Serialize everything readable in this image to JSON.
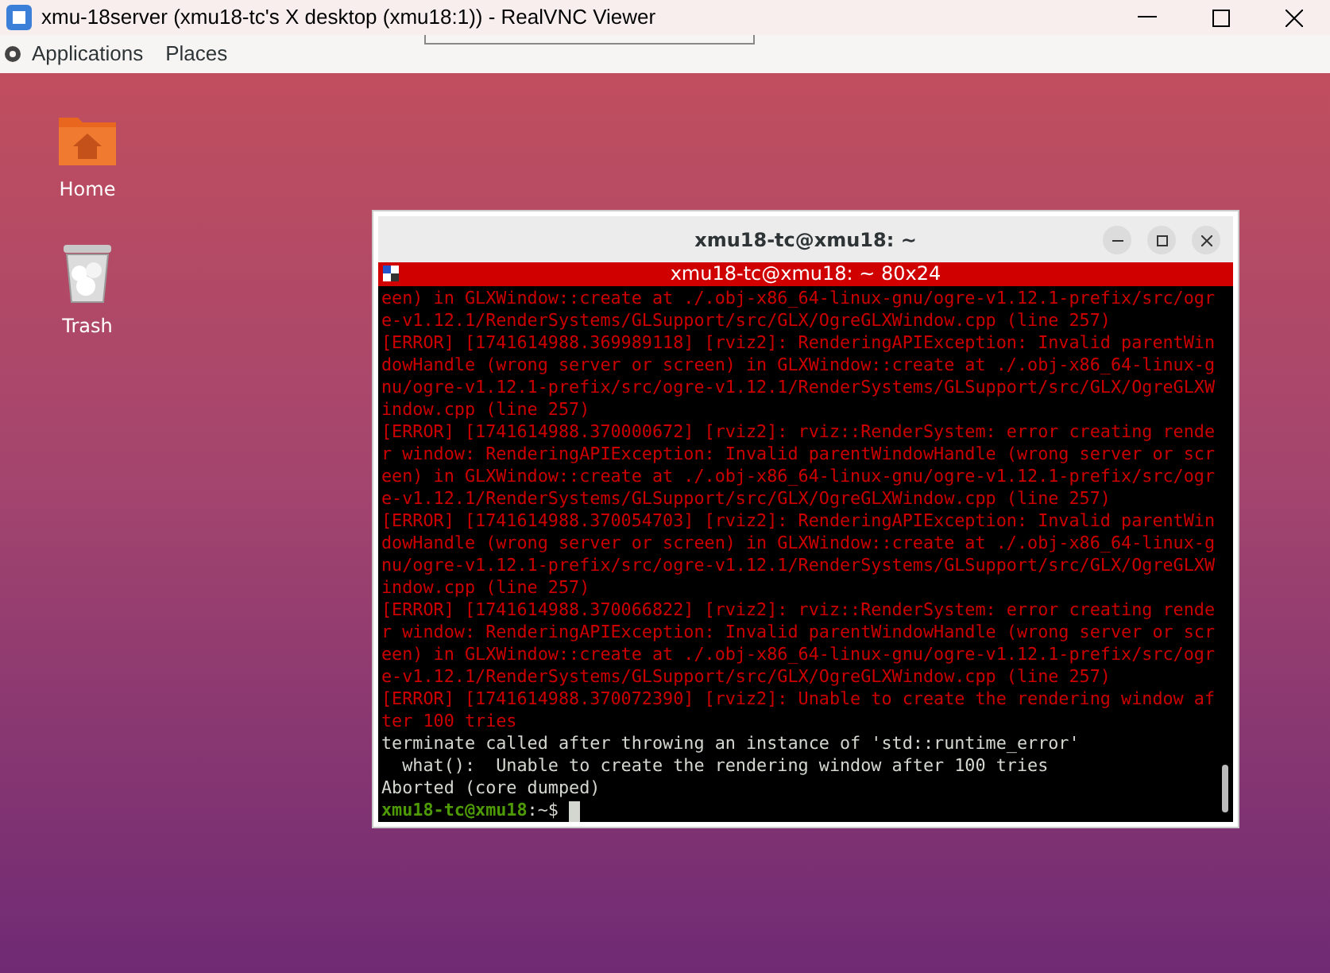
{
  "window": {
    "title": "xmu-18server (xmu18-tc's X desktop (xmu18:1)) - RealVNC Viewer"
  },
  "top_panel": {
    "menus": [
      "Applications",
      "Places"
    ]
  },
  "desktop_icons": [
    {
      "kind": "folder",
      "label": "Home"
    },
    {
      "kind": "trash",
      "label": "Trash"
    }
  ],
  "terminal": {
    "title": "xmu18-tc@xmu18: ~",
    "bar_title": "xmu18-tc@xmu18: ~ 80x24",
    "lines": [
      {
        "kind": "error",
        "text": "een) in GLXWindow::create at ./.obj-x86_64-linux-gnu/ogre-v1.12.1-prefix/src/ogr"
      },
      {
        "kind": "error",
        "text": "e-v1.12.1/RenderSystems/GLSupport/src/GLX/OgreGLXWindow.cpp (line 257)"
      },
      {
        "kind": "error",
        "text": "[ERROR] [1741614988.369989118] [rviz2]: RenderingAPIException: Invalid parentWin"
      },
      {
        "kind": "error",
        "text": "dowHandle (wrong server or screen) in GLXWindow::create at ./.obj-x86_64-linux-g"
      },
      {
        "kind": "error",
        "text": "nu/ogre-v1.12.1-prefix/src/ogre-v1.12.1/RenderSystems/GLSupport/src/GLX/OgreGLXW"
      },
      {
        "kind": "error",
        "text": "indow.cpp (line 257)"
      },
      {
        "kind": "error",
        "text": "[ERROR] [1741614988.370000672] [rviz2]: rviz::RenderSystem: error creating rende"
      },
      {
        "kind": "error",
        "text": "r window: RenderingAPIException: Invalid parentWindowHandle (wrong server or scr"
      },
      {
        "kind": "error",
        "text": "een) in GLXWindow::create at ./.obj-x86_64-linux-gnu/ogre-v1.12.1-prefix/src/ogr"
      },
      {
        "kind": "error",
        "text": "e-v1.12.1/RenderSystems/GLSupport/src/GLX/OgreGLXWindow.cpp (line 257)"
      },
      {
        "kind": "error",
        "text": "[ERROR] [1741614988.370054703] [rviz2]: RenderingAPIException: Invalid parentWin"
      },
      {
        "kind": "error",
        "text": "dowHandle (wrong server or screen) in GLXWindow::create at ./.obj-x86_64-linux-g"
      },
      {
        "kind": "error",
        "text": "nu/ogre-v1.12.1-prefix/src/ogre-v1.12.1/RenderSystems/GLSupport/src/GLX/OgreGLXW"
      },
      {
        "kind": "error",
        "text": "indow.cpp (line 257)"
      },
      {
        "kind": "error",
        "text": "[ERROR] [1741614988.370066822] [rviz2]: rviz::RenderSystem: error creating rende"
      },
      {
        "kind": "error",
        "text": "r window: RenderingAPIException: Invalid parentWindowHandle (wrong server or scr"
      },
      {
        "kind": "error",
        "text": "een) in GLXWindow::create at ./.obj-x86_64-linux-gnu/ogre-v1.12.1-prefix/src/ogr"
      },
      {
        "kind": "error",
        "text": "e-v1.12.1/RenderSystems/GLSupport/src/GLX/OgreGLXWindow.cpp (line 257)"
      },
      {
        "kind": "error",
        "text": "[ERROR] [1741614988.370072390] [rviz2]: Unable to create the rendering window af"
      },
      {
        "kind": "error",
        "text": "ter 100 tries"
      },
      {
        "kind": "normal",
        "text": "terminate called after throwing an instance of 'std::runtime_error'"
      },
      {
        "kind": "normal",
        "text": "  what():  Unable to create the rendering window after 100 tries"
      },
      {
        "kind": "normal",
        "text": "Aborted (core dumped)"
      }
    ],
    "prompt": {
      "user": "xmu18-tc@xmu18",
      "path": ":~$"
    }
  }
}
